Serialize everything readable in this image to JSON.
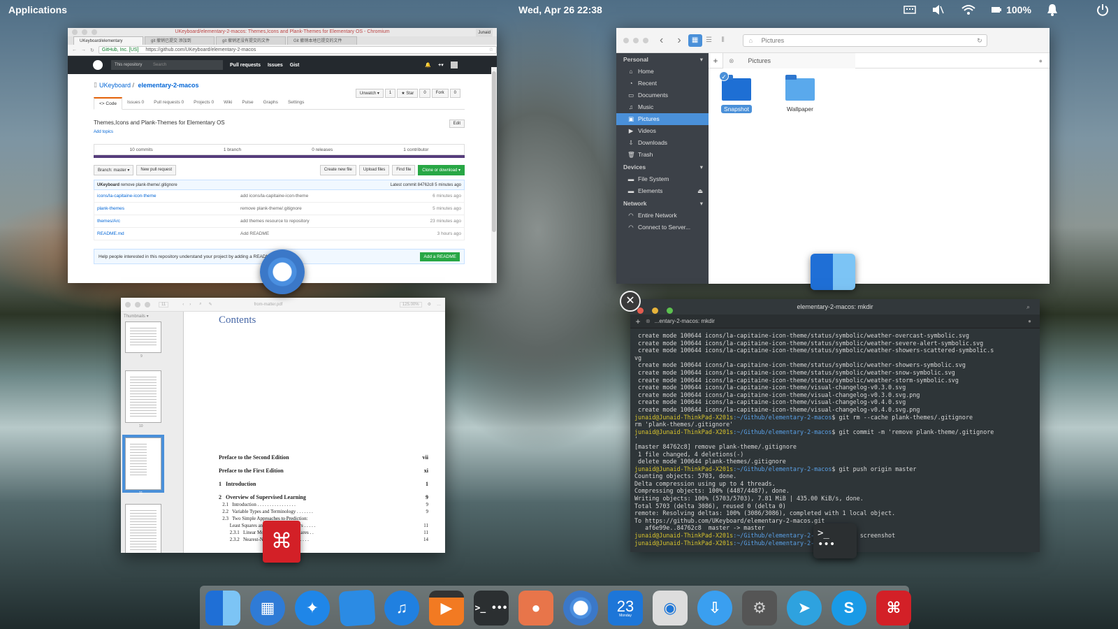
{
  "topbar": {
    "applications": "Applications",
    "datetime": "Wed, Apr 26   22:38",
    "battery": "100%"
  },
  "chromium": {
    "window_title": "UKeyboard/elementary-2-macos: Themes,Icons and Plank-Themes for Elementary OS - Chromium",
    "user": "Junaid",
    "tabs": [
      "UKeyboard/elementary",
      "git 撤销已提交 添加到",
      "git 撤销还没有提交的文件",
      "Git 撤销本地已提交的文件"
    ],
    "secure": "GitHub, Inc. [US]",
    "url": "https://github.com/UKeyboard/elementary-2-macos",
    "gh": {
      "search_scope": "This repository",
      "search_placeholder": "Search",
      "nav": [
        "Pull requests",
        "Issues",
        "Gist"
      ]
    },
    "repo": {
      "owner": "UKeyboard",
      "sep": " / ",
      "name": "elementary-2-macos",
      "watch": "Unwatch ▾",
      "watch_n": "1",
      "star": "★ Star",
      "star_n": "0",
      "fork": "Fork",
      "fork_n": "0"
    },
    "repo_tabs": [
      "<> Code",
      "Issues 0",
      "Pull requests 0",
      "Projects 0",
      "Wiki",
      "Pulse",
      "Graphs",
      "Settings"
    ],
    "description": "Themes,Icons and Plank-Themes for Elementary OS",
    "edit": "Edit",
    "add_topics": "Add topics",
    "stats": [
      "10 commits",
      "1 branch",
      "0 releases",
      "1 contributor"
    ],
    "branch": "Branch: master ▾",
    "new_pr": "New pull request",
    "create": "Create new file",
    "upload": "Upload files",
    "find": "Find file",
    "clone": "Clone or download ▾",
    "commit_author": "UKeyboard",
    "commit_msg": " remove plank-theme/.gitignore",
    "latest_commit": "Latest commit 84762c8 5 minutes ago",
    "files": [
      {
        "name": "icons/la-capitaine-icon-theme",
        "msg": "add icons/la-capitaine-icon-theme",
        "time": "6 minutes ago"
      },
      {
        "name": "plank-themes",
        "msg": "remove plank-theme/.gitignore",
        "time": "5 minutes ago"
      },
      {
        "name": "themes/Arc",
        "msg": "add themes resource to repository",
        "time": "23 minutes ago"
      },
      {
        "name": "README.md",
        "msg": "Add README",
        "time": "3 hours ago"
      }
    ],
    "help": "Help people interested in this repository understand your project by adding a README.",
    "add_readme": "Add a README"
  },
  "files_app": {
    "location": "Pictures",
    "tab": "Pictures",
    "personal": "Personal",
    "devices": "Devices",
    "network": "Network",
    "items": [
      "Home",
      "Recent",
      "Documents",
      "Music",
      "Pictures",
      "Videos",
      "Downloads",
      "Trash"
    ],
    "device_items": [
      "File System",
      "Elements"
    ],
    "network_items": [
      "Entire Network",
      "Connect to Server..."
    ],
    "folders": [
      "Snapshot",
      "Wallpaper"
    ]
  },
  "pdf": {
    "file": "from-matter.pdf",
    "page": "11",
    "zoom": "125.00%",
    "sidebar": "Thumbnails",
    "thumb_labels": [
      "9",
      "10",
      "11"
    ],
    "heading": "Contents",
    "toc": [
      {
        "t": "Preface to the Second Edition",
        "p": "vii",
        "b": true
      },
      {
        "t": "Preface to the First Edition",
        "p": "xi",
        "b": true
      },
      {
        "t": "1   Introduction",
        "p": "1",
        "b": true
      },
      {
        "t": "2   Overview of Supervised Learning",
        "p": "9",
        "b": true
      },
      {
        "t": "   2.1   Introduction . . . . . . . . . . . . . . . .",
        "p": "9",
        "b": false
      },
      {
        "t": "   2.2   Variable Types and Terminology . . . . . . .",
        "p": "9",
        "b": false
      },
      {
        "t": "   2.3   Two Simple Approaches to Prediction:",
        "p": "",
        "b": false
      },
      {
        "t": "         Least Squares and Nearest Neighbors . . . . .",
        "p": "11",
        "b": false
      },
      {
        "t": "         2.3.1   Linear Models and Least Squares . .",
        "p": "11",
        "b": false
      },
      {
        "t": "         2.3.2   Nearest-Neighbor Methods . . . . .",
        "p": "14",
        "b": false
      }
    ]
  },
  "terminal": {
    "title": "elementary-2-macos: mkdir",
    "tab": "...entary-2-macos: mkdir",
    "lines": [
      {
        "c": "o",
        "t": " create mode 100644 icons/la-capitaine-icon-theme/status/symbolic/weather-overcast-symbolic.svg"
      },
      {
        "c": "o",
        "t": " create mode 100644 icons/la-capitaine-icon-theme/status/symbolic/weather-severe-alert-symbolic.svg"
      },
      {
        "c": "o",
        "t": " create mode 100644 icons/la-capitaine-icon-theme/status/symbolic/weather-showers-scattered-symbolic.s"
      },
      {
        "c": "o",
        "t": "vg"
      },
      {
        "c": "o",
        "t": " create mode 100644 icons/la-capitaine-icon-theme/status/symbolic/weather-showers-symbolic.svg"
      },
      {
        "c": "o",
        "t": " create mode 100644 icons/la-capitaine-icon-theme/status/symbolic/weather-snow-symbolic.svg"
      },
      {
        "c": "o",
        "t": " create mode 100644 icons/la-capitaine-icon-theme/status/symbolic/weather-storm-symbolic.svg"
      },
      {
        "c": "o",
        "t": " create mode 100644 icons/la-capitaine-icon-theme/visual-changelog-v0.3.0.svg"
      },
      {
        "c": "o",
        "t": " create mode 100644 icons/la-capitaine-icon-theme/visual-changelog-v0.3.0.svg.png"
      },
      {
        "c": "o",
        "t": " create mode 100644 icons/la-capitaine-icon-theme/visual-changelog-v0.4.0.svg"
      },
      {
        "c": "o",
        "t": " create mode 100644 icons/la-capitaine-icon-theme/visual-changelog-v0.4.0.svg.png"
      },
      {
        "c": "p",
        "u": "junaid@Junaid-ThinkPad-X201s",
        "d": ":~/Github/elementary-2-macos",
        "t": "$ git rm --cache plank-themes/.gitignore"
      },
      {
        "c": "o",
        "t": "rm 'plank-themes/.gitignore'"
      },
      {
        "c": "p",
        "u": "junaid@Junaid-ThinkPad-X201s",
        "d": ":~/Github/elementary-2-macos",
        "t": "$ git commit -m 'remove plank-theme/.gitignore"
      },
      {
        "c": "o",
        "t": "'"
      },
      {
        "c": "o",
        "t": "[master 84762c8] remove plank-theme/.gitignore"
      },
      {
        "c": "o",
        "t": " 1 file changed, 4 deletions(-)"
      },
      {
        "c": "o",
        "t": " delete mode 100644 plank-themes/.gitignore"
      },
      {
        "c": "p",
        "u": "junaid@Junaid-ThinkPad-X201s",
        "d": ":~/Github/elementary-2-macos",
        "t": "$ git push origin master"
      },
      {
        "c": "o",
        "t": "Counting objects: 5703, done."
      },
      {
        "c": "o",
        "t": "Delta compression using up to 4 threads."
      },
      {
        "c": "o",
        "t": "Compressing objects: 100% (4487/4487), done."
      },
      {
        "c": "o",
        "t": "Writing objects: 100% (5703/5703), 7.81 MiB | 435.00 KiB/s, done."
      },
      {
        "c": "o",
        "t": "Total 5703 (delta 3086), reused 0 (delta 0)"
      },
      {
        "c": "o",
        "t": "remote: Resolving deltas: 100% (3086/3086), completed with 1 local object."
      },
      {
        "c": "o",
        "t": "To https://github.com/UKeyboard/elementary-2-macos.git"
      },
      {
        "c": "o",
        "t": "   af6e99e..84762c8  master -> master"
      },
      {
        "c": "p",
        "u": "junaid@Junaid-ThinkPad-X201s",
        "d": ":~/Github/elementary-2-macos",
        "t": "$ mkdir screenshot"
      },
      {
        "c": "p",
        "u": "junaid@Junaid-ThinkPad-X201s",
        "d": ":~/Github/elementary-2-macos",
        "t": "$ █"
      }
    ]
  },
  "dock": {
    "calendar_day": "23",
    "calendar_label": "Monday",
    "apps": [
      "finder-icon",
      "multitask-icon",
      "safari-icon",
      "notes-icon",
      "music-icon",
      "videos-icon",
      "terminal-icon",
      "screenshot-icon",
      "chromium-icon",
      "calendar-icon",
      "camera-icon",
      "downloader-icon",
      "settings-icon",
      "telegram-icon",
      "skype-icon",
      "pdf-reader-icon"
    ]
  }
}
